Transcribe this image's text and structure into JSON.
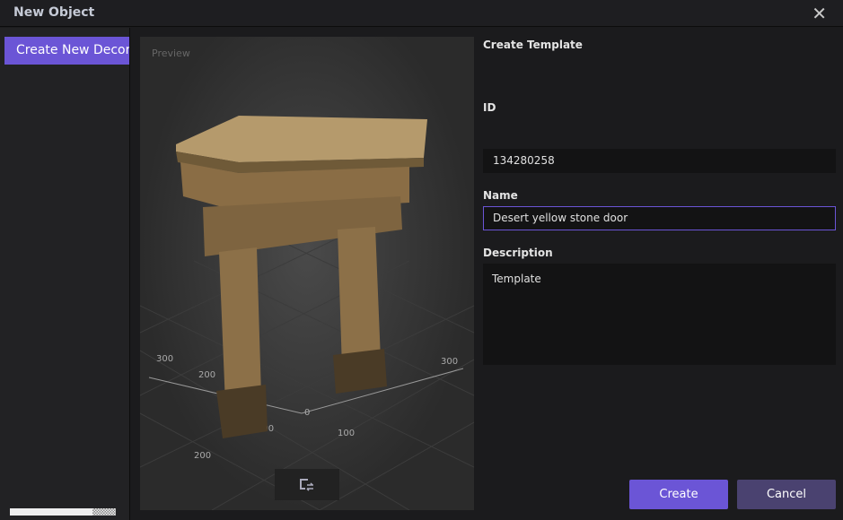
{
  "window": {
    "title": "New Object",
    "close_icon": "close-icon"
  },
  "sidebar": {
    "items": [
      {
        "label": "Create New Decoration"
      }
    ]
  },
  "preview": {
    "label": "Preview",
    "axis_ticks": [
      "300",
      "200",
      "100",
      "0",
      "100",
      "200",
      "300"
    ],
    "button_icon": "swap-view-icon"
  },
  "form": {
    "heading": "Create Template",
    "id_label": "ID",
    "id_value": "134280258",
    "name_label": "Name",
    "name_value": "Desert yellow stone door",
    "description_label": "Description",
    "description_value": "Template"
  },
  "buttons": {
    "create": "Create",
    "cancel": "Cancel"
  },
  "colors": {
    "accent": "#6b55d6",
    "cancel": "#4a4270"
  }
}
